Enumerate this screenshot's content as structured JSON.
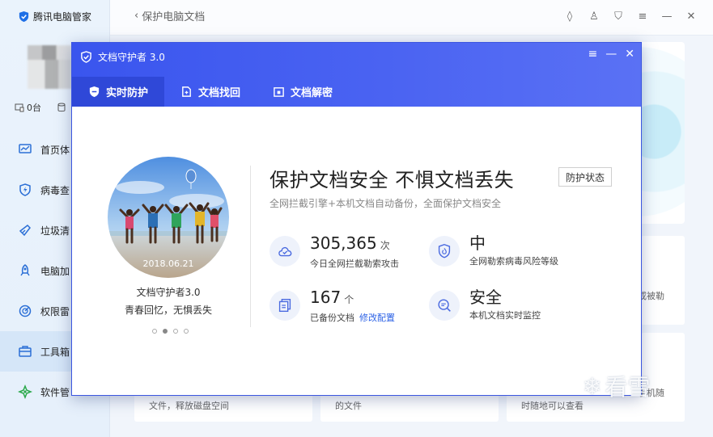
{
  "app": {
    "brand": "腾讯电脑管家",
    "device_count": "0台",
    "back_label": "保护电脑文档",
    "nav": [
      {
        "label": "首页体",
        "icon": "monitor-icon"
      },
      {
        "label": "病毒查",
        "icon": "shield-bolt-icon"
      },
      {
        "label": "垃圾清",
        "icon": "broom-icon"
      },
      {
        "label": "电脑加",
        "icon": "rocket-icon"
      },
      {
        "label": "权限雷",
        "icon": "radar-icon"
      },
      {
        "label": "工具箱",
        "icon": "toolbox-icon"
      },
      {
        "label": "软件管",
        "icon": "apps-icon"
      }
    ],
    "bg_texts": {
      "t1": "或被勒",
      "t2": "文件，释放磁盘空间",
      "t3": "的文件",
      "t4": "时随地可以查看",
      "t5": "手机随"
    }
  },
  "dialog": {
    "title": "文档守护者 3.0",
    "tabs": [
      {
        "label": "实时防护",
        "active": true
      },
      {
        "label": "文档找回",
        "active": false
      },
      {
        "label": "文档解密",
        "active": false
      }
    ],
    "photo_date": "2018.06.21",
    "caption1": "文档守护者3.0",
    "caption2": "青春回忆，无惧丢失",
    "headline": "保护文档安全  不惧文档丢失",
    "status_button": "防护状态",
    "subline": "全网拦截引擎+本机文档自动备份，全面保护文档安全",
    "stats": [
      {
        "value": "305,365",
        "unit": "次",
        "desc": "今日全网拦截勒索攻击",
        "icon": "cloud-shield-icon"
      },
      {
        "value": "中",
        "unit": "",
        "desc": "全网勒索病毒风险等级",
        "icon": "shield-icon"
      },
      {
        "value": "167",
        "unit": "个",
        "desc": "已备份文档",
        "link": "修改配置",
        "icon": "documents-icon"
      },
      {
        "value": "安全",
        "unit": "",
        "desc": "本机文档实时监控",
        "icon": "monitor-search-icon"
      }
    ]
  },
  "watermark": "看雪",
  "colors": {
    "accent": "#3a55ee",
    "tab_active": "#2f48d8",
    "link": "#2e63e6"
  }
}
